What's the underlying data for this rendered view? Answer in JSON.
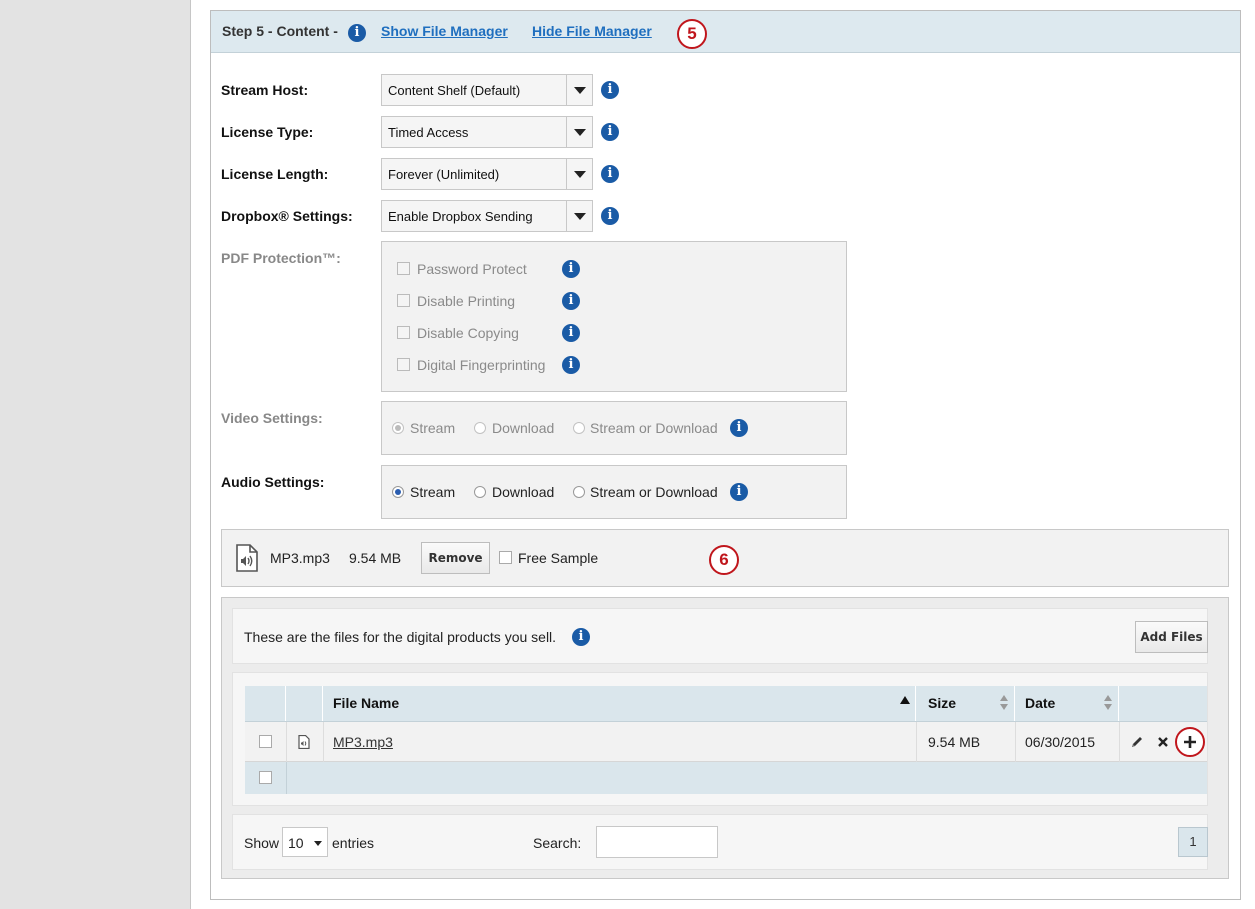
{
  "step": {
    "title": "Step 5 - Content -",
    "show_link": "Show File Manager",
    "hide_link": "Hide File Manager",
    "callout": "5"
  },
  "form": {
    "stream_host": {
      "label": "Stream Host:",
      "value": "Content Shelf (Default)"
    },
    "license_type": {
      "label": "License Type:",
      "value": "Timed Access"
    },
    "license_length": {
      "label": "License Length:",
      "value": "Forever (Unlimited)"
    },
    "dropbox": {
      "label": "Dropbox® Settings:",
      "value": "Enable Dropbox Sending"
    },
    "pdf": {
      "label": "PDF Protection™:",
      "options": [
        "Password Protect",
        "Disable Printing",
        "Disable Copying",
        "Digital Fingerprinting"
      ]
    },
    "video": {
      "label": "Video Settings:",
      "options": [
        "Stream",
        "Download",
        "Stream or Download"
      ],
      "selected": "Stream"
    },
    "audio": {
      "label": "Audio Settings:",
      "options": [
        "Stream",
        "Download",
        "Stream or Download"
      ],
      "selected": "Stream"
    }
  },
  "attached_file": {
    "name": "MP3.mp3",
    "size": "9.54 MB",
    "remove_label": "Remove",
    "free_sample_label": "Free Sample",
    "callout": "6"
  },
  "file_manager": {
    "description": "These are the files for the digital products you sell.",
    "add_files_label": "Add Files",
    "columns": [
      "File Name",
      "Size",
      "Date"
    ],
    "rows": [
      {
        "name": "MP3.mp3",
        "size": "9.54 MB",
        "date": "06/30/2015"
      }
    ],
    "show_label": "Show",
    "entries_value": "10",
    "entries_label": "entries",
    "search_label": "Search:",
    "search_value": "",
    "page": "1"
  },
  "colors": {
    "accent": "#1a5ba6",
    "callout": "#c0161c",
    "header_bg": "#dde9ef",
    "link": "#1f6fbf"
  }
}
